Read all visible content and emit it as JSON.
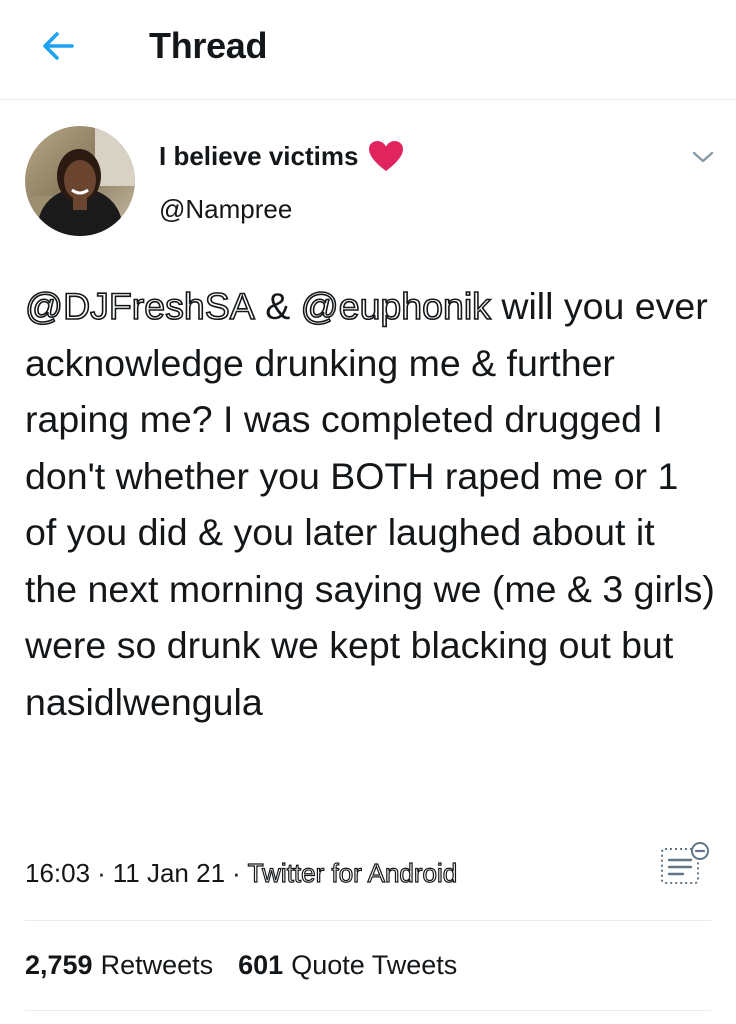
{
  "header": {
    "title": "Thread",
    "back_icon": "arrow-left-icon",
    "accent_color": "#1da1f2"
  },
  "tweet": {
    "author": {
      "display_name": "I believe victims",
      "name_emoji": "red-heart-icon",
      "username": "@Nampree"
    },
    "text": {
      "mention_1": "@DJFreshSA",
      "connector": " & ",
      "mention_2": "@euphonik",
      "body": " will you ever acknowledge drunking me & further raping me? I was completed drugged I don't whether you BOTH raped me or 1 of you did & you later laughed about it the next morning saying we (me & 3 girls) were so drunk we kept blacking out but nasidlwengula"
    },
    "meta": {
      "time": "16:03",
      "separator": "·",
      "date": "11 Jan 21",
      "source": "Twitter for Android"
    },
    "stats": {
      "retweets_count": "2,759",
      "retweets_label": "Retweets",
      "quotes_count": "601",
      "quotes_label": "Quote Tweets"
    }
  },
  "colors": {
    "text": "#14171a",
    "divider": "#e6ecf0",
    "heart": "#e0245e",
    "icon_gray": "#8899a6"
  }
}
